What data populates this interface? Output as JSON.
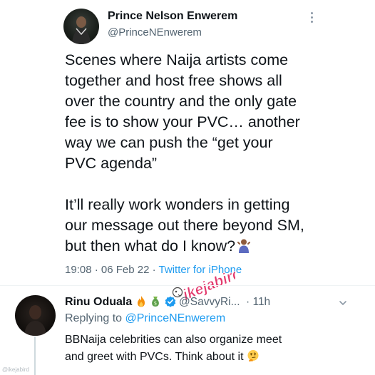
{
  "main_tweet": {
    "display_name": "Prince Nelson Enwerem",
    "handle": "@PrinceNEnwerem",
    "paragraph_1": "Scenes where Naija artists come\ntogether and host free shows all\nover the country and the only gate\nfee is to show your PVC… another\nway we can push the “get your\nPVC agenda”",
    "paragraph_2": "It’ll really work wonders in getting\nour message out there beyond SM,\nbut then what do I know?",
    "time": "19:08",
    "date": "06 Feb 22",
    "separator": "·",
    "source": "Twitter for iPhone"
  },
  "watermark": {
    "brand": "ikejabird"
  },
  "reply": {
    "display_name": "Rinu Oduala",
    "handle": "@SavvyRi...",
    "time": "· 11h",
    "replying_to_prefix": "Replying to",
    "replying_to_mention": "@PrinceNEnwerem",
    "text": "BBNaija celebrities can also organize meet\nand greet with PVCs. Think about it"
  },
  "corner_mark": "@ikejabird",
  "colors": {
    "link": "#1d9bf0",
    "secondary_text": "#536471",
    "verified": "#1d9bf0",
    "watermark": "#e0245e"
  },
  "icons": [
    "more-vertical-icon",
    "person-shrugging-emoji",
    "fire-emoji",
    "money-bag-emoji",
    "verified-badge-icon",
    "chevron-down-icon",
    "thinking-face-emoji"
  ]
}
